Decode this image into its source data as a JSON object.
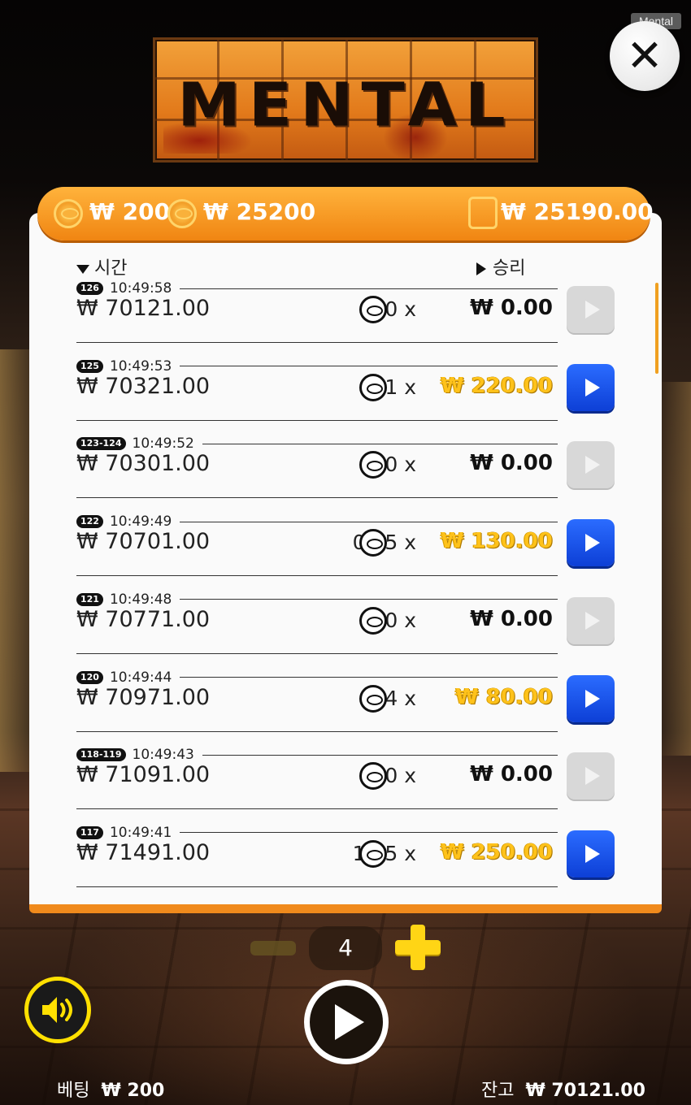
{
  "app_tag": "Mental",
  "title": "MENTAL",
  "topbar": {
    "bet_value": "₩ 200",
    "total_value": "₩ 25200",
    "wallet_value": "₩ 25190.00"
  },
  "headers": {
    "time": "시간",
    "win": "승리"
  },
  "rows": [
    {
      "badge": "126",
      "time": "10:49:58",
      "amount": "₩ 70121.00",
      "mult": "0 x",
      "win": "₩ 0.00",
      "replay": false
    },
    {
      "badge": "125",
      "time": "10:49:53",
      "amount": "₩ 70321.00",
      "mult": "1.1 x",
      "win": "₩ 220.00",
      "replay": true
    },
    {
      "badge": "123-124",
      "time": "10:49:52",
      "amount": "₩ 70301.00",
      "mult": "0 x",
      "win": "₩ 0.00",
      "replay": false
    },
    {
      "badge": "122",
      "time": "10:49:49",
      "amount": "₩ 70701.00",
      "mult": "0.65 x",
      "win": "₩ 130.00",
      "replay": true
    },
    {
      "badge": "121",
      "time": "10:49:48",
      "amount": "₩ 70771.00",
      "mult": "0 x",
      "win": "₩ 0.00",
      "replay": false
    },
    {
      "badge": "120",
      "time": "10:49:44",
      "amount": "₩ 70971.00",
      "mult": "0.4 x",
      "win": "₩ 80.00",
      "replay": true
    },
    {
      "badge": "118-119",
      "time": "10:49:43",
      "amount": "₩ 71091.00",
      "mult": "0 x",
      "win": "₩ 0.00",
      "replay": false
    },
    {
      "badge": "117",
      "time": "10:49:41",
      "amount": "₩ 71491.00",
      "mult": "1.25 x",
      "win": "₩ 250.00",
      "replay": true
    }
  ],
  "pager": {
    "page": "4"
  },
  "footer": {
    "bet_label": "베팅",
    "bet_value": "₩ 200",
    "balance_label": "잔고",
    "balance_value": "₩ 70121.00"
  },
  "colors": {
    "accent": "#f08a1c",
    "replay_on": "#1a55f0",
    "win_gold": "#ffc21a"
  }
}
